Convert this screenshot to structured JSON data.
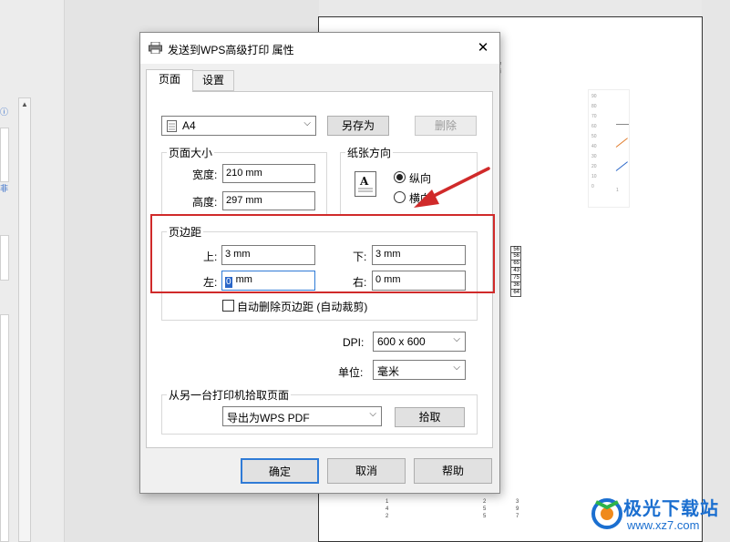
{
  "dialog": {
    "title": "发送到WPS高级打印 属性",
    "close_label": "✕",
    "tabs": [
      {
        "label": "页面",
        "active": true
      },
      {
        "label": "设置",
        "active": false
      }
    ],
    "paper": {
      "size_value": "A4",
      "save_as_label": "另存为",
      "delete_label": "删除"
    },
    "page_size": {
      "label": "页面大小",
      "width_label": "宽度:",
      "width_value": "210 mm",
      "height_label": "高度:",
      "height_value": "297 mm"
    },
    "orientation": {
      "label": "纸张方向",
      "portrait_label": "纵向",
      "landscape_label": "横向",
      "selected": "portrait"
    },
    "margins": {
      "label": "页边距",
      "top_label": "上:",
      "top_value": "3 mm",
      "bottom_label": "下:",
      "bottom_value": "3 mm",
      "left_label": "左:",
      "left_value": "0",
      "left_suffix": " mm",
      "right_label": "右:",
      "right_value": "0 mm",
      "auto_delete_label": "自动删除页边距 (自动裁剪)",
      "auto_delete_checked": false
    },
    "dpi": {
      "label": "DPI:",
      "value": "600 x 600"
    },
    "unit": {
      "label": "单位:",
      "value": "毫米"
    },
    "source_printer": {
      "label": "从另一台打印机拾取页面",
      "value": "导出为WPS PDF",
      "pick_label": "拾取"
    },
    "footer": {
      "ok_label": "确定",
      "cancel_label": "取消",
      "help_label": "帮助"
    }
  },
  "document_preview": {
    "heading_fragment_1": "奶",
    "heading_fragment_2": "南",
    "chart_ticks": [
      "90",
      "80",
      "70",
      "60",
      "50",
      "40",
      "30",
      "20",
      "10",
      "0"
    ],
    "chart_xlabel": "1",
    "table_values": [
      "56",
      "56",
      "65",
      "43",
      "75",
      "36",
      "64"
    ],
    "bottom_rows": [
      [
        "1",
        "2",
        "3"
      ],
      [
        "4",
        "5",
        "9"
      ],
      [
        "2",
        "5",
        "7"
      ]
    ]
  },
  "watermark": {
    "brand": "极光下载站",
    "url": "www.xz7.com"
  },
  "colors": {
    "accent_red": "#d02a2a",
    "focus_blue": "#2f7bd6",
    "brand_blue": "#1b6fd0"
  }
}
